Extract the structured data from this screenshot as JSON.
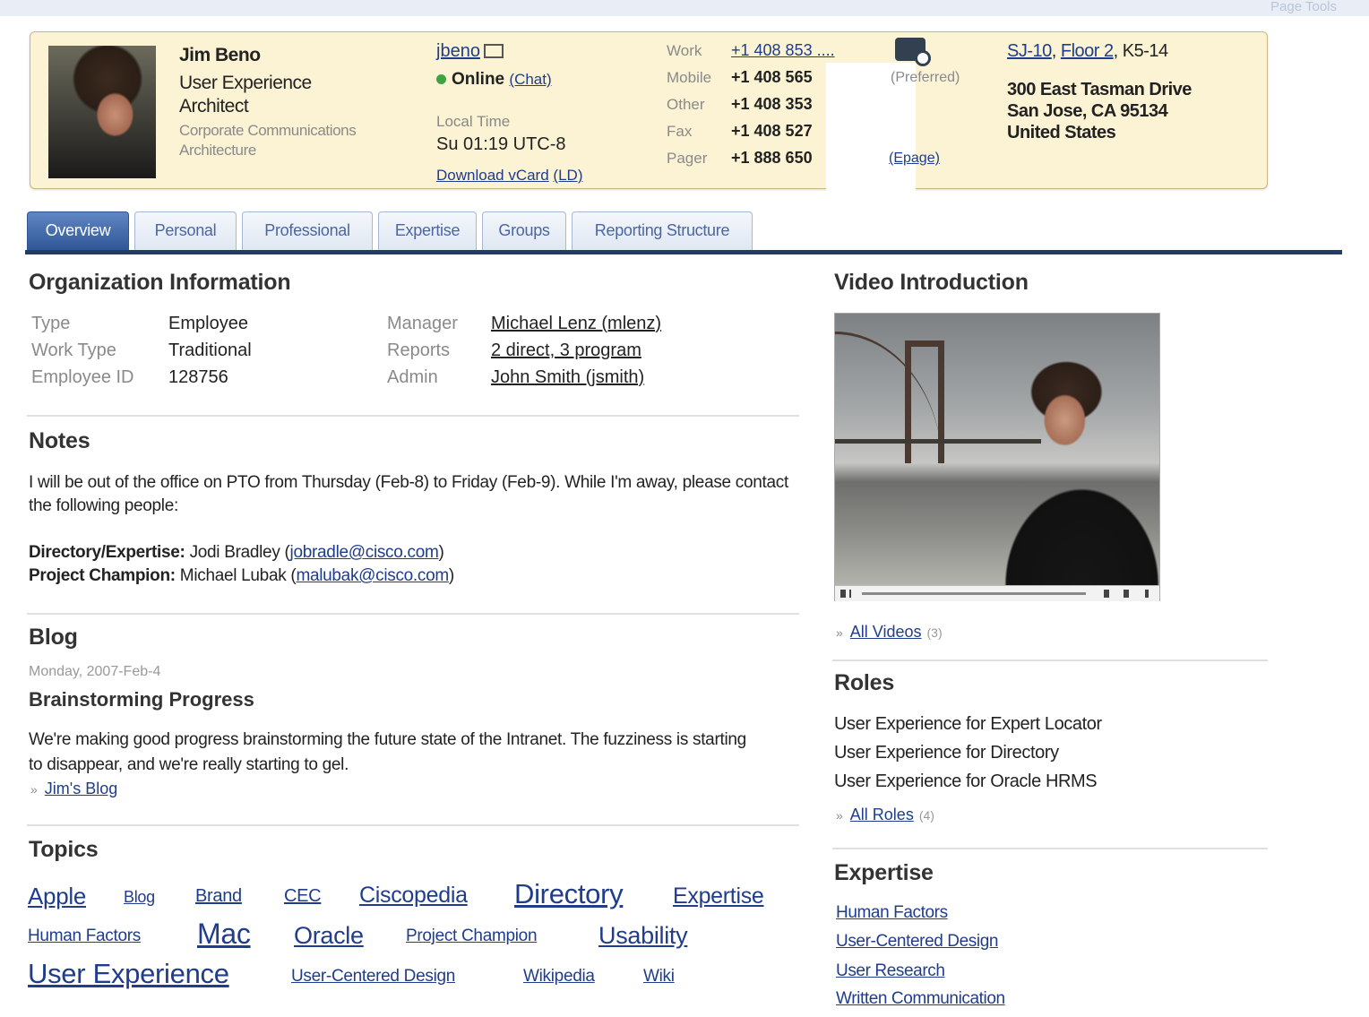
{
  "colors": {
    "link": "#1f3d8a",
    "card_bg": "#fbf3d4",
    "tab_active": "#2f5597",
    "tab_line": "#203d66",
    "online": "#3da343"
  },
  "topbar": {
    "page_tools": "Page Tools"
  },
  "profile": {
    "name": "Jim Beno",
    "title": "User Experience Architect",
    "department": "Corporate Communications Architecture",
    "userid": "jbeno",
    "status": "Online",
    "chat_label": "(Chat)",
    "local_time_label": "Local Time",
    "local_time": "Su 01:19 UTC-8",
    "vcard_label": "Download vCard",
    "vcard_extra": "(LD)",
    "phones": [
      {
        "label": "Work",
        "number": "+1 408 853 ...."
      },
      {
        "label": "Mobile",
        "number": "+1 408 565"
      },
      {
        "label": "Other",
        "number": "+1 408 353"
      },
      {
        "label": "Fax",
        "number": "+1 408 527"
      },
      {
        "label": "Pager",
        "number": "+1 888 650"
      }
    ],
    "preferred_label": "(Preferred)",
    "epage_label": "(Epage)",
    "location_link_1": "SJ-10",
    "location_link_2": "Floor 2",
    "location_cube": "K5-14",
    "address": [
      "300 East Tasman Drive",
      "San Jose, CA 95134",
      "United States"
    ]
  },
  "tabs": [
    "Overview",
    "Personal",
    "Professional",
    "Expertise",
    "Groups",
    "Reporting Structure"
  ],
  "org": {
    "heading": "Organization Information",
    "left": [
      {
        "label": "Type",
        "value": "Employee"
      },
      {
        "label": "Work Type",
        "value": "Traditional"
      },
      {
        "label": "Employee ID",
        "value": "128756"
      }
    ],
    "right": [
      {
        "label": "Manager",
        "value": "Michael Lenz (mlenz)"
      },
      {
        "label": "Reports",
        "value": "2 direct, 3 program"
      },
      {
        "label": "Admin",
        "value": "John Smith (jsmith)"
      }
    ]
  },
  "notes": {
    "heading": "Notes",
    "body": "I will be out of the office on PTO from Thursday (Feb-8) to Friday (Feb-9). While I'm away, please contact the following people:",
    "contact1_label": "Directory/Expertise:",
    "contact1_name": "Jodi Bradley",
    "contact1_email": "jobradle@cisco.com",
    "contact2_label": "Project Champion:",
    "contact2_name": "Michael Lubak",
    "contact2_email": "malubak@cisco.com"
  },
  "blog": {
    "heading": "Blog",
    "date": "Monday, 2007-Feb-4",
    "title": "Brainstorming Progress",
    "body": "We're making good progress brainstorming the future state of the Intranet. The fuzziness is starting to disappear, and we're really starting to gel.",
    "more_link": "Jim's Blog"
  },
  "topics": {
    "heading": "Topics",
    "tags": [
      "Apple",
      "Blog",
      "Brand",
      "CEC",
      "Ciscopedia",
      "Directory",
      "Expertise",
      "Human Factors",
      "Mac",
      "Oracle",
      "Project Champion",
      "Usability",
      "User Experience",
      "User-Centered Design",
      "Wikipedia",
      "Wiki"
    ]
  },
  "video": {
    "heading": "Video Introduction",
    "all_link": "All Videos",
    "count": "(3)"
  },
  "roles": {
    "heading": "Roles",
    "items": [
      "User Experience for Expert Locator",
      "User Experience for Directory",
      "User Experience for Oracle HRMS"
    ],
    "all_link": "All Roles",
    "count": "(4)"
  },
  "expertise": {
    "heading": "Expertise",
    "items": [
      "Human Factors",
      "User-Centered Design",
      "User Research",
      "Written Communication"
    ]
  }
}
